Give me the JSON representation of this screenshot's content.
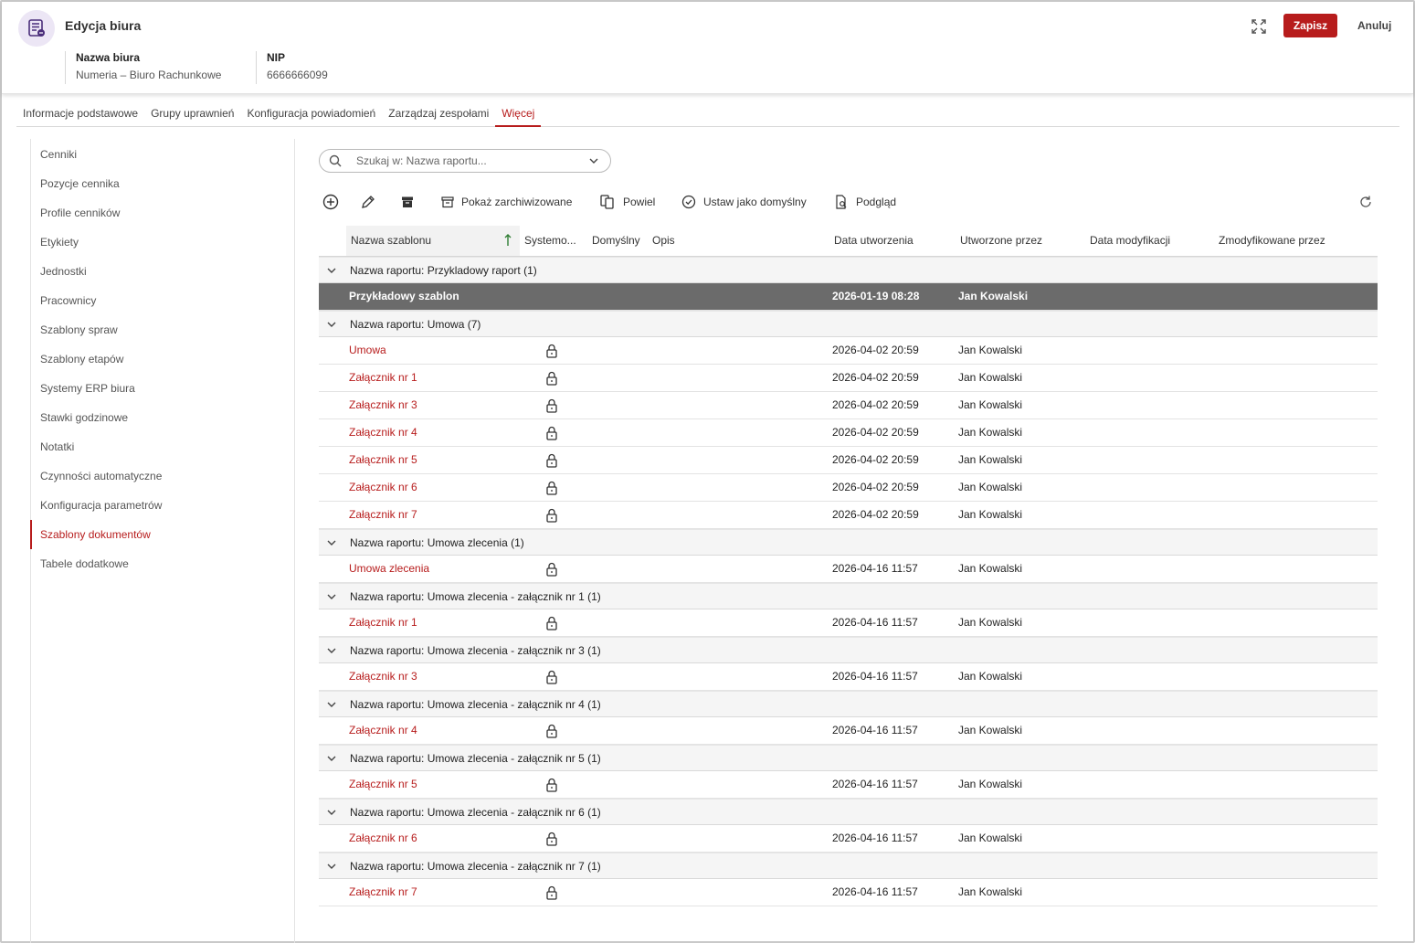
{
  "header": {
    "title": "Edycja biura",
    "office_name_label": "Nazwa biura",
    "office_name_value": "Numeria – Biuro Rachunkowe",
    "nip_label": "NIP",
    "nip_value": "6666666099",
    "save_label": "Zapisz",
    "cancel_label": "Anuluj",
    "accent_color": "#b71c1c"
  },
  "tabs": [
    {
      "label": "Informacje podstawowe",
      "active": false
    },
    {
      "label": "Grupy uprawnień",
      "active": false
    },
    {
      "label": "Konfiguracja powiadomień",
      "active": false
    },
    {
      "label": "Zarządzaj zespołami",
      "active": false
    },
    {
      "label": "Więcej",
      "active": true
    }
  ],
  "sidebar": {
    "items": [
      {
        "label": "Cenniki",
        "active": false
      },
      {
        "label": "Pozycje cennika",
        "active": false
      },
      {
        "label": "Profile cenników",
        "active": false
      },
      {
        "label": "Etykiety",
        "active": false
      },
      {
        "label": "Jednostki",
        "active": false
      },
      {
        "label": "Pracownicy",
        "active": false
      },
      {
        "label": "Szablony spraw",
        "active": false
      },
      {
        "label": "Szablony etapów",
        "active": false
      },
      {
        "label": "Systemy ERP biura",
        "active": false
      },
      {
        "label": "Stawki godzinowe",
        "active": false
      },
      {
        "label": "Notatki",
        "active": false
      },
      {
        "label": "Czynności automatyczne",
        "active": false
      },
      {
        "label": "Konfiguracja parametrów",
        "active": false
      },
      {
        "label": "Szablony dokumentów",
        "active": true
      },
      {
        "label": "Tabele dodatkowe",
        "active": false
      }
    ]
  },
  "search": {
    "placeholder": "Szukaj w: Nazwa raportu...",
    "value": ""
  },
  "toolbar": {
    "add_icon": "plus-circle-icon",
    "edit_icon": "pencil-icon",
    "archive_icon": "archive-icon",
    "show_archived_label": "Pokaż zarchiwizowane",
    "duplicate_label": "Powiel",
    "set_default_label": "Ustaw jako domyślny",
    "preview_label": "Podgląd",
    "refresh_icon": "refresh-icon"
  },
  "grid": {
    "columns": [
      "Nazwa szablonu",
      "Systemo...",
      "Domyślny",
      "Opis",
      "Data utworzenia",
      "Utworzone przez",
      "Data modyfikacji",
      "Zmodyfikowane przez"
    ],
    "sorted_column": "Nazwa szablonu",
    "sort_direction": "ascending",
    "groups": [
      {
        "label": "Nazwa raportu: Przykladowy raport (1)",
        "rows": [
          {
            "name": "Przykładowy szablon",
            "system": false,
            "created": "2026-01-19 08:28",
            "created_by": "Jan Kowalski",
            "selected": true
          }
        ]
      },
      {
        "label": "Nazwa raportu: Umowa (7)",
        "rows": [
          {
            "name": "Umowa",
            "system": true,
            "created": "2026-04-02 20:59",
            "created_by": "Jan Kowalski"
          },
          {
            "name": "Załącznik nr 1",
            "system": true,
            "created": "2026-04-02 20:59",
            "created_by": "Jan Kowalski"
          },
          {
            "name": "Załącznik nr 3",
            "system": true,
            "created": "2026-04-02 20:59",
            "created_by": "Jan Kowalski"
          },
          {
            "name": "Załącznik nr 4",
            "system": true,
            "created": "2026-04-02 20:59",
            "created_by": "Jan Kowalski"
          },
          {
            "name": "Załącznik nr 5",
            "system": true,
            "created": "2026-04-02 20:59",
            "created_by": "Jan Kowalski"
          },
          {
            "name": "Załącznik nr 6",
            "system": true,
            "created": "2026-04-02 20:59",
            "created_by": "Jan Kowalski"
          },
          {
            "name": "Załącznik nr 7",
            "system": true,
            "created": "2026-04-02 20:59",
            "created_by": "Jan Kowalski"
          }
        ]
      },
      {
        "label": "Nazwa raportu: Umowa zlecenia (1)",
        "rows": [
          {
            "name": "Umowa zlecenia",
            "system": true,
            "created": "2026-04-16 11:57",
            "created_by": "Jan Kowalski"
          }
        ]
      },
      {
        "label": "Nazwa raportu: Umowa zlecenia - załącznik nr 1 (1)",
        "rows": [
          {
            "name": "Załącznik nr 1",
            "system": true,
            "created": "2026-04-16 11:57",
            "created_by": "Jan Kowalski"
          }
        ]
      },
      {
        "label": "Nazwa raportu: Umowa zlecenia - załącznik nr 3 (1)",
        "rows": [
          {
            "name": "Załącznik nr 3",
            "system": true,
            "created": "2026-04-16 11:57",
            "created_by": "Jan Kowalski"
          }
        ]
      },
      {
        "label": "Nazwa raportu: Umowa zlecenia - załącznik nr 4 (1)",
        "rows": [
          {
            "name": "Załącznik nr 4",
            "system": true,
            "created": "2026-04-16 11:57",
            "created_by": "Jan Kowalski"
          }
        ]
      },
      {
        "label": "Nazwa raportu: Umowa zlecenia - załącznik nr 5 (1)",
        "rows": [
          {
            "name": "Załącznik nr 5",
            "system": true,
            "created": "2026-04-16 11:57",
            "created_by": "Jan Kowalski"
          }
        ]
      },
      {
        "label": "Nazwa raportu: Umowa zlecenia - załącznik nr 6 (1)",
        "rows": [
          {
            "name": "Załącznik nr 6",
            "system": true,
            "created": "2026-04-16 11:57",
            "created_by": "Jan Kowalski"
          }
        ]
      },
      {
        "label": "Nazwa raportu: Umowa zlecenia - załącznik nr 7 (1)",
        "rows": [
          {
            "name": "Załącznik nr 7",
            "system": true,
            "created": "2026-04-16 11:57",
            "created_by": "Jan Kowalski"
          }
        ]
      }
    ]
  }
}
